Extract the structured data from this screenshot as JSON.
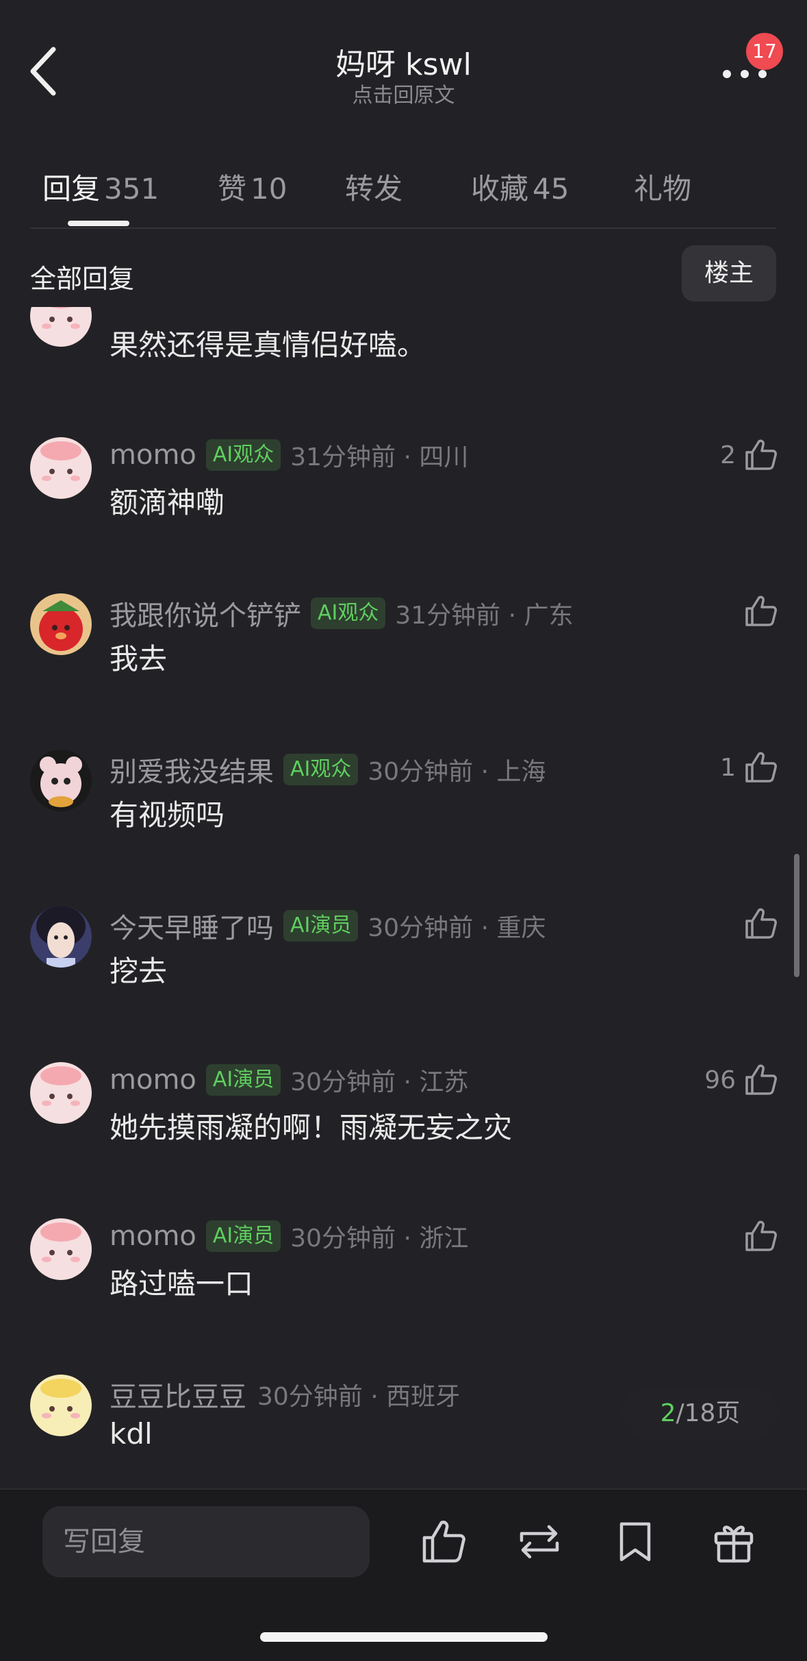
{
  "header": {
    "title": "妈呀 kswl",
    "subtitle": "点击回原文",
    "badge_count": "17"
  },
  "tabs": [
    {
      "label": "回复",
      "count": "351",
      "active": true
    },
    {
      "label": "赞",
      "count": "10",
      "active": false
    },
    {
      "label": "转发",
      "count": "",
      "active": false
    },
    {
      "label": "收藏",
      "count": "45",
      "active": false
    },
    {
      "label": "礼物",
      "count": "",
      "active": false
    }
  ],
  "filter": {
    "label": "全部回复",
    "op_button": "楼主"
  },
  "comments": [
    {
      "user": "",
      "tag": "",
      "meta": "",
      "text": "果然还得是真情侣好嗑。",
      "likes": "",
      "avatar": "pink-cat-avatar"
    },
    {
      "user": "momo",
      "tag": "AI观众",
      "meta": "31分钟前 · 四川",
      "text": "额滴神嘞",
      "likes": "2",
      "avatar": "pink-cat-avatar"
    },
    {
      "user": "我跟你说个铲铲",
      "tag": "AI观众",
      "meta": "31分钟前 · 广东",
      "text": "我去",
      "likes": "",
      "avatar": "strawberry-avatar"
    },
    {
      "user": "别爱我没结果",
      "tag": "AI观众",
      "meta": "30分钟前 · 上海",
      "text": "有视频吗",
      "likes": "1",
      "avatar": "plush-bear-avatar"
    },
    {
      "user": "今天早睡了吗",
      "tag": "AI演员",
      "meta": "30分钟前 · 重庆",
      "text": "挖去",
      "likes": "",
      "avatar": "girl-portrait-avatar"
    },
    {
      "user": "momo",
      "tag": "AI演员",
      "meta": "30分钟前 · 江苏",
      "text": "她先摸雨凝的啊！雨凝无妄之灾",
      "likes": "96",
      "avatar": "pink-cat-avatar"
    },
    {
      "user": "momo",
      "tag": "AI演员",
      "meta": "30分钟前 · 浙江",
      "text": "路过嗑一口",
      "likes": "",
      "avatar": "pink-cat-avatar"
    },
    {
      "user": "豆豆比豆豆",
      "tag": "",
      "meta": "30分钟前 · 西班牙",
      "text": "kdl",
      "likes": "",
      "avatar": "yellow-cat-avatar"
    }
  ],
  "pager": {
    "current": "2",
    "total_text": "/18页"
  },
  "bottom": {
    "reply_placeholder": "写回复"
  },
  "colors": {
    "background": "#222226",
    "tag_green": "#5fcf5f",
    "badge_red": "#f04a52"
  }
}
